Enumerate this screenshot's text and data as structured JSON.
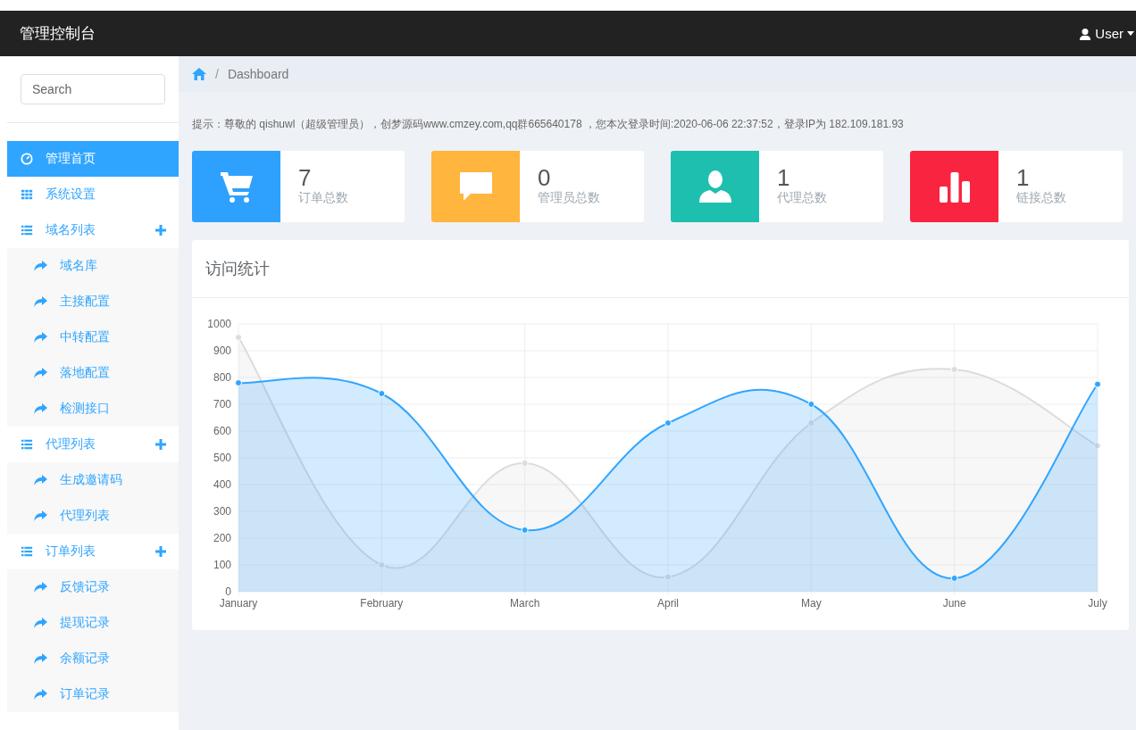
{
  "topbar": {
    "title": "管理控制台",
    "user": "User"
  },
  "sidebar": {
    "search": {
      "placeholder": "Search"
    },
    "items": [
      {
        "label": "管理首页",
        "kind": "dashboard",
        "selected": true
      },
      {
        "label": "系统设置",
        "kind": "grid",
        "selected": false
      },
      {
        "label": "域名列表",
        "kind": "list",
        "selected": false,
        "children": [
          {
            "label": "域名库",
            "selected": false
          },
          {
            "label": "主接配置",
            "selected": false
          },
          {
            "label": "中转配置",
            "selected": false
          },
          {
            "label": "落地配置",
            "selected": false
          },
          {
            "label": "检测接口",
            "selected": false
          }
        ]
      },
      {
        "label": "代理列表",
        "kind": "list",
        "selected": false,
        "children": [
          {
            "label": "生成邀请码",
            "selected": false
          },
          {
            "label": "代理列表",
            "selected": false
          }
        ]
      },
      {
        "label": "订单列表",
        "kind": "list",
        "selected": false,
        "children": [
          {
            "label": "反馈记录",
            "selected": false
          },
          {
            "label": "提现记录",
            "selected": false
          },
          {
            "label": "余额记录",
            "selected": false
          },
          {
            "label": "订单记录",
            "selected": false
          }
        ]
      }
    ]
  },
  "breadcrumb": {
    "separator": "/",
    "items": [
      "Dashboard"
    ]
  },
  "notice": "提示：尊敬的 qishuwl（超级管理员），创梦源码www.cmzey.com,qq群665640178 ，您本次登录时间:2020-06-06 22:37:52，登录IP为 182.109.181.93",
  "stats": [
    {
      "value": "7",
      "label": "订单总数",
      "kind": "cart",
      "color": "#2ea1ff"
    },
    {
      "value": "0",
      "label": "管理员总数",
      "kind": "comment",
      "color": "#ffb53e"
    },
    {
      "value": "1",
      "label": "代理总数",
      "kind": "user",
      "color": "#1ebfae"
    },
    {
      "value": "1",
      "label": "链接总数",
      "kind": "bars",
      "color": "#f9243f"
    }
  ],
  "panel": {
    "title": "访问统计",
    "chart_data": {
      "type": "area",
      "categories": [
        "January",
        "February",
        "March",
        "April",
        "May",
        "June",
        "July"
      ],
      "ylim": [
        0,
        1000
      ],
      "yticks": [
        0,
        100,
        200,
        300,
        400,
        500,
        600,
        700,
        800,
        900,
        1000
      ],
      "grid": true,
      "series": [
        {
          "color": "#dcdcdc",
          "values": [
            950,
            100,
            480,
            55,
            630,
            830,
            545
          ]
        },
        {
          "color": "#30a5ff",
          "values": [
            780,
            740,
            230,
            630,
            700,
            50,
            775
          ]
        }
      ]
    }
  }
}
